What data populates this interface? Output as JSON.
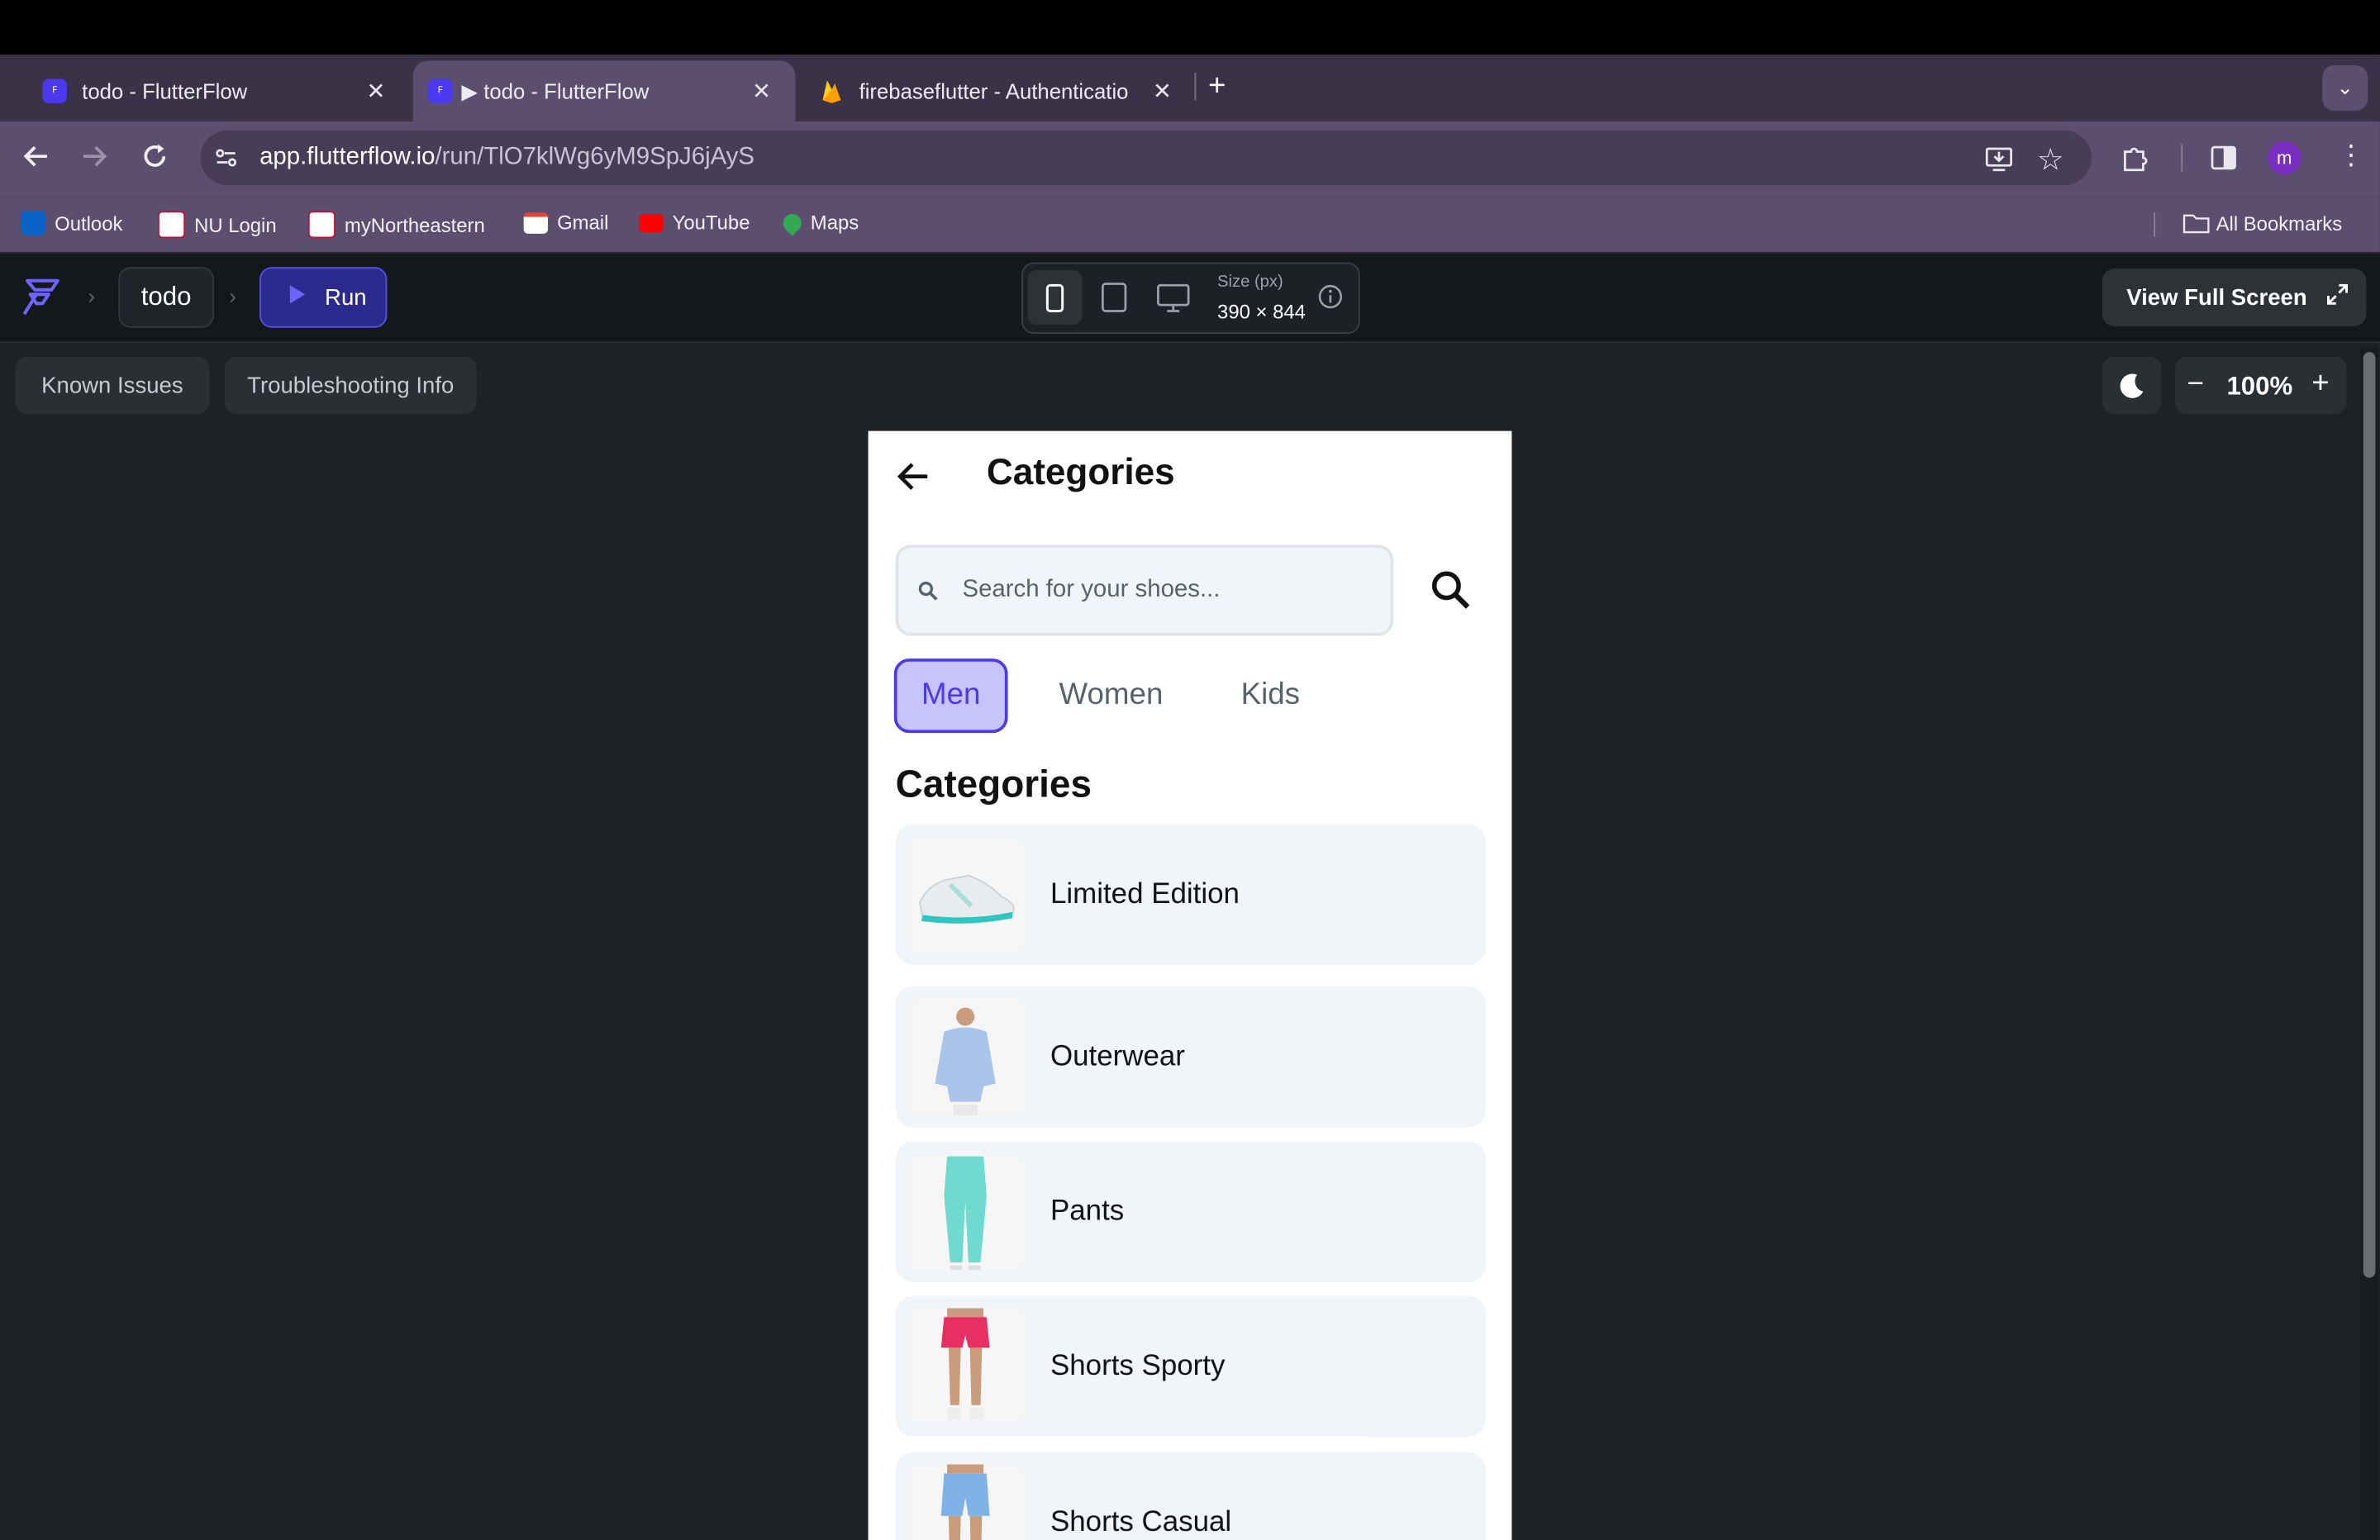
{
  "browser": {
    "tabs": [
      {
        "title": "todo - FlutterFlow"
      },
      {
        "title": "▶ todo - FlutterFlow"
      },
      {
        "title": "firebaseflutter - Authenticatio"
      }
    ],
    "url_host": "app.flutterflow.io",
    "url_path": "/run/TlO7klWg6yM9SpJ6jAyS",
    "profile_initial": "m",
    "bookmarks": [
      "Outlook",
      "NU Login",
      "myNortheastern",
      "Gmail",
      "YouTube",
      "Maps"
    ],
    "all_bookmarks": "All Bookmarks"
  },
  "flutterflow": {
    "project": "todo",
    "run_label": "Run",
    "size_label": "Size (px)",
    "size_value": "390 × 844",
    "view_full_screen": "View Full Screen",
    "known_issues": "Known Issues",
    "troubleshooting": "Troubleshooting Info",
    "zoom": "100%"
  },
  "app": {
    "title": "Categories",
    "search_placeholder": "Search for your shoes...",
    "tabs": [
      "Men",
      "Women",
      "Kids"
    ],
    "selected_tab": "Men",
    "section_title": "Categories",
    "categories": [
      {
        "label": "Limited Edition",
        "image": "sneaker"
      },
      {
        "label": "Outerwear",
        "image": "hoodie"
      },
      {
        "label": "Pants",
        "image": "pants"
      },
      {
        "label": "Shorts Sporty",
        "image": "shorts-pink"
      },
      {
        "label": "Shorts Casual",
        "image": "shorts-blue"
      }
    ]
  },
  "colors": {
    "accent": "#4b39ef",
    "accent_bg": "#c7c3fb",
    "tab_strip": "#3a3247",
    "toolbar": "#5b4e6e"
  }
}
